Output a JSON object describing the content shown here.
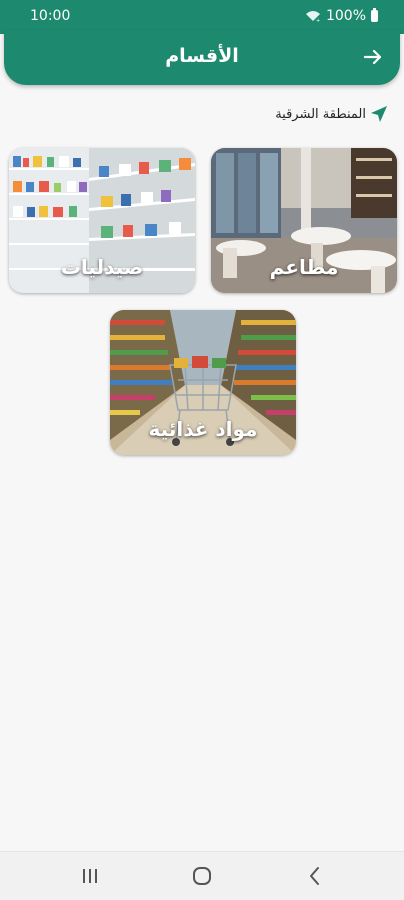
{
  "status_bar": {
    "time": "10:00",
    "battery": "100%"
  },
  "header": {
    "title": "الأقسام",
    "back_icon": "arrow-right-icon"
  },
  "location": {
    "label": "المنطقة الشرقية",
    "icon": "navigation-arrow-icon",
    "color": "#1d8a6f"
  },
  "categories": [
    {
      "label": "مطاعم",
      "image": "restaurant-interior"
    },
    {
      "label": "صيدليات",
      "image": "pharmacy-shelves"
    },
    {
      "label": "مواد غذائية",
      "image": "supermarket-aisle"
    }
  ],
  "colors": {
    "primary": "#1d8a6f",
    "background": "#f7f7f7"
  },
  "system_nav": {
    "icons": [
      "recents-icon",
      "home-icon",
      "back-chevron-icon"
    ]
  }
}
